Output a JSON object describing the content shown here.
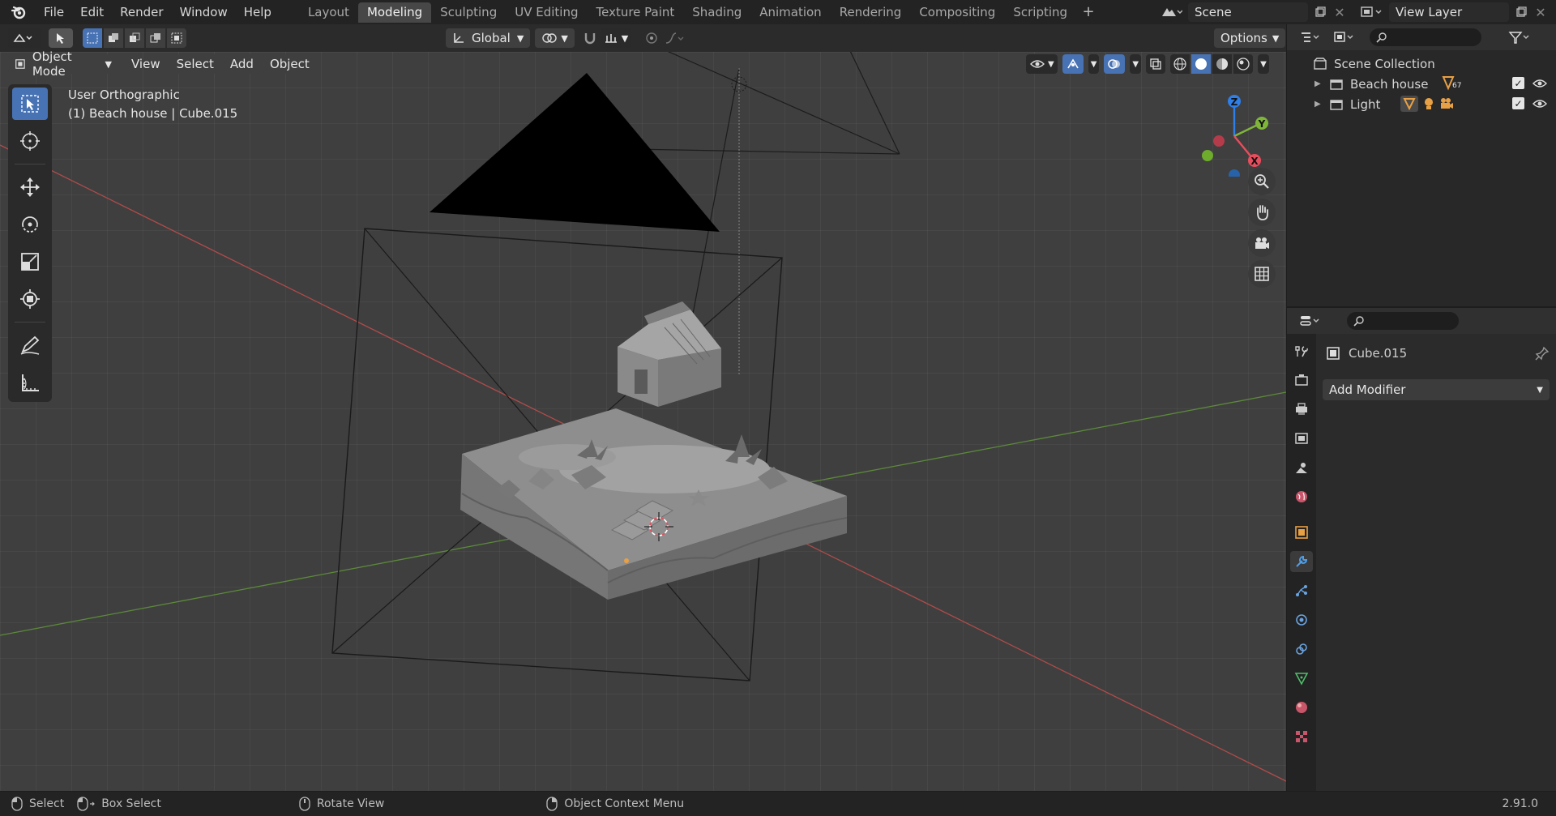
{
  "menu": {
    "file": "File",
    "edit": "Edit",
    "render": "Render",
    "window": "Window",
    "help": "Help"
  },
  "workspaces": [
    {
      "label": "Layout"
    },
    {
      "label": "Modeling"
    },
    {
      "label": "Sculpting"
    },
    {
      "label": "UV Editing"
    },
    {
      "label": "Texture Paint"
    },
    {
      "label": "Shading"
    },
    {
      "label": "Animation"
    },
    {
      "label": "Rendering"
    },
    {
      "label": "Compositing"
    },
    {
      "label": "Scripting"
    }
  ],
  "active_workspace": "Modeling",
  "scene": {
    "name": "Scene"
  },
  "view_layer": {
    "name": "View Layer"
  },
  "viewport": {
    "mode": "Object Mode",
    "menus": {
      "view": "View",
      "select": "Select",
      "add": "Add",
      "object": "Object"
    },
    "transform_orientation": "Global",
    "options_label": "Options",
    "view_name": "User Orthographic",
    "context": "(1) Beach house | Cube.015"
  },
  "outliner": {
    "root": "Scene Collection",
    "items": [
      {
        "label": "Beach house",
        "badge": "67"
      },
      {
        "label": "Light"
      }
    ]
  },
  "properties": {
    "object_name": "Cube.015",
    "add_modifier": "Add Modifier"
  },
  "statusbar": {
    "select": "Select",
    "box_select": "Box Select",
    "rotate_view": "Rotate View",
    "context_menu": "Object Context Menu",
    "version": "2.91.0"
  },
  "colors": {
    "accent": "#4772b3",
    "axis_x": "#e84d5d",
    "axis_y": "#7fb63a",
    "axis_z": "#2f7fe8",
    "orange": "#e8a045"
  }
}
